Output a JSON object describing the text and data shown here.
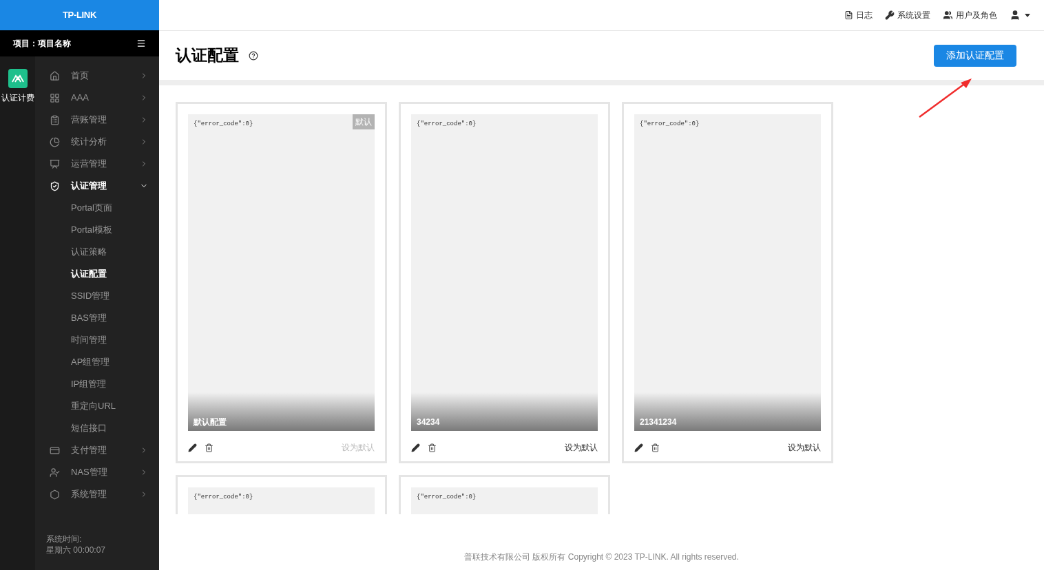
{
  "brand": {
    "logo": "TP-LINK"
  },
  "project": {
    "label": "项目：项目名称"
  },
  "app": {
    "name": "认证计费"
  },
  "menu": [
    {
      "label": "首页",
      "expanded": false,
      "selected": false
    },
    {
      "label": "AAA",
      "expanded": false,
      "selected": false
    },
    {
      "label": "营账管理",
      "expanded": false,
      "selected": false
    },
    {
      "label": "统计分析",
      "expanded": false,
      "selected": false
    },
    {
      "label": "运营管理",
      "expanded": false,
      "selected": false
    },
    {
      "label": "认证管理",
      "expanded": true,
      "selected": true,
      "children": [
        {
          "label": "Portal页面",
          "selected": false
        },
        {
          "label": "Portal模板",
          "selected": false
        },
        {
          "label": "认证策略",
          "selected": false
        },
        {
          "label": "认证配置",
          "selected": true
        },
        {
          "label": "SSID管理",
          "selected": false
        },
        {
          "label": "BAS管理",
          "selected": false
        },
        {
          "label": "时间管理",
          "selected": false
        },
        {
          "label": "AP组管理",
          "selected": false
        },
        {
          "label": "IP组管理",
          "selected": false
        },
        {
          "label": "重定向URL",
          "selected": false
        },
        {
          "label": "短信接口",
          "selected": false
        }
      ]
    },
    {
      "label": "支付管理",
      "expanded": false,
      "selected": false
    },
    {
      "label": "NAS管理",
      "expanded": false,
      "selected": false
    },
    {
      "label": "系统管理",
      "expanded": false,
      "selected": false
    }
  ],
  "system_time": {
    "label": "系统时间:",
    "value": "星期六 00:00:07"
  },
  "topbar": {
    "links": [
      "日志",
      "系统设置",
      "用户及角色"
    ]
  },
  "page": {
    "title": "认证配置",
    "add_button": "添加认证配置"
  },
  "cards": [
    {
      "preview": "{\"error_code\":0}",
      "badge": "默认",
      "name": "默认配置",
      "set_default": {
        "label": "设为默认",
        "disabled": true
      }
    },
    {
      "preview": "{\"error_code\":0}",
      "name": "34234",
      "set_default": {
        "label": "设为默认",
        "disabled": false
      }
    },
    {
      "preview": "{\"error_code\":0}",
      "name": "21341234",
      "set_default": {
        "label": "设为默认",
        "disabled": false
      }
    },
    {
      "preview": "{\"error_code\":0}"
    },
    {
      "preview": "{\"error_code\":0}"
    }
  ],
  "footer": "普联技术有限公司 版权所有 Copyright © 2023 TP-LINK. All rights reserved."
}
